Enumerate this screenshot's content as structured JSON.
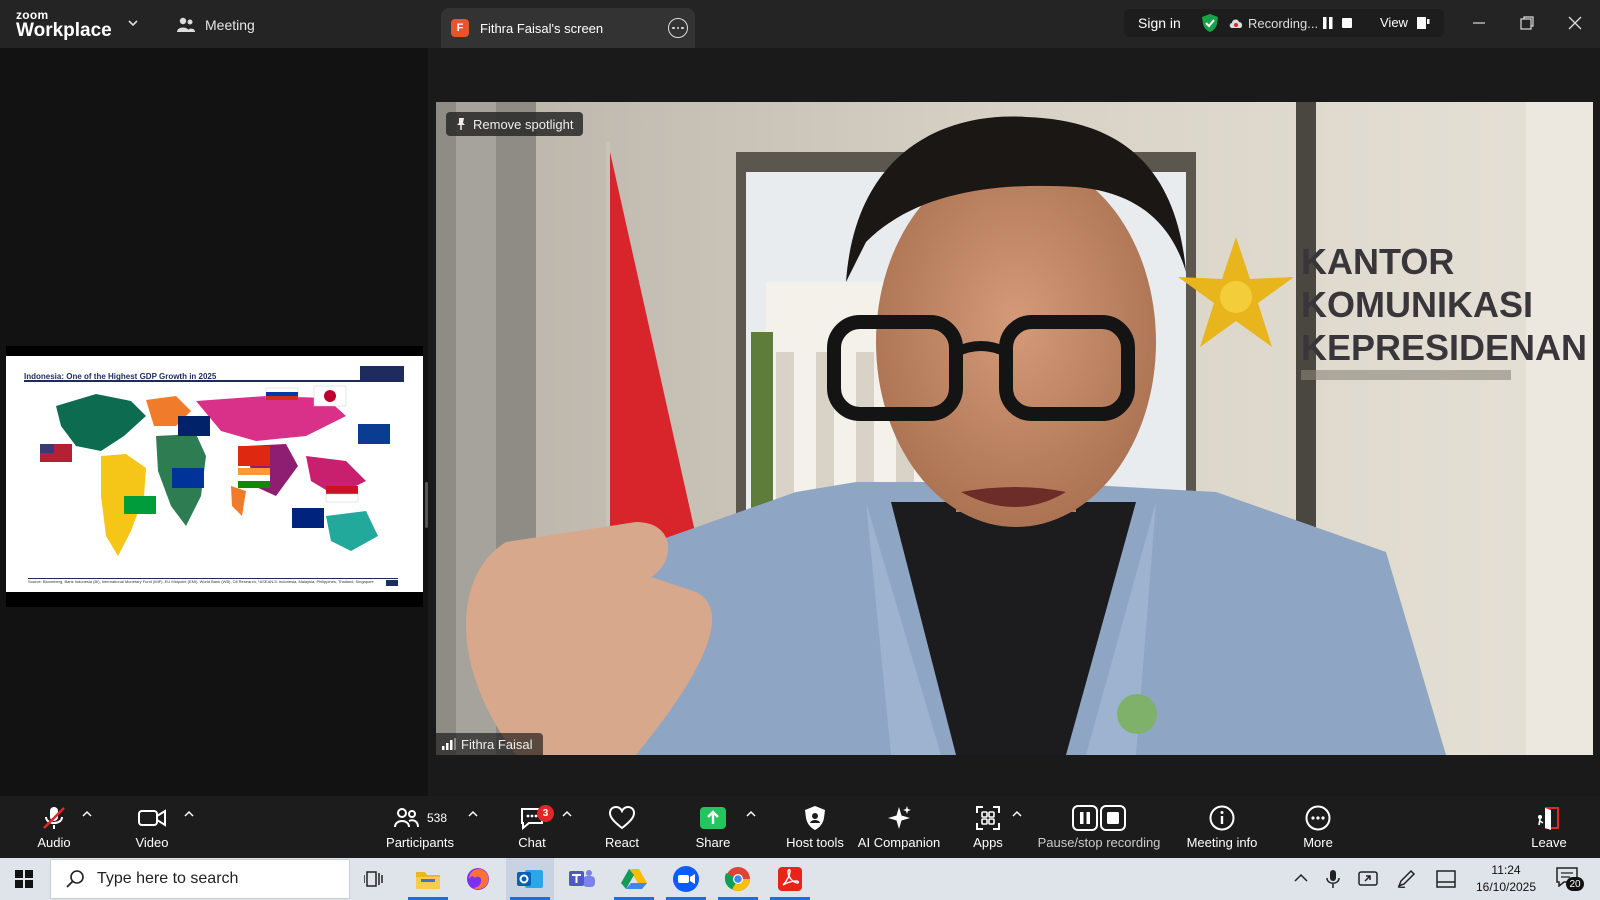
{
  "app": {
    "logo_top": "zoom",
    "logo_bottom": "Workplace",
    "meeting_tab": "Meeting",
    "screen_tab_badge": "F",
    "screen_tab_label": "Fithra Faisal's screen"
  },
  "status": {
    "sign_in": "Sign in",
    "recording": "Recording...",
    "view": "View"
  },
  "colors": {
    "accent_green": "#16a34a",
    "share_green": "#22c55e",
    "badge_red": "#e02828",
    "zoom_blue": "#0b5cff"
  },
  "slide": {
    "title": "Indonesia: One of the Highest GDP Growth in 2025",
    "source": "Source: Bloomberg, Bank Indonesia (BI), International Monetary Fund (IMF), EU Midpoint (EMI), World Bank (WB), Oil Research, *ASEAN-5: Indonesia, Malaysia, Philippines, Thailand, Singapore",
    "labels": [
      "USA",
      "UK",
      "Russia",
      "Japan",
      "China",
      "Eurozone",
      "India",
      "Brazil",
      "Australia",
      "ASEAN-5",
      "Indonesia"
    ]
  },
  "video": {
    "spotlight_button": "Remove spotlight",
    "participant_name": "Fithra Faisal",
    "backdrop_lines": [
      "KANTOR",
      "KOMUNIKASI",
      "KEPRESIDENAN"
    ]
  },
  "toolbar": {
    "audio": "Audio",
    "video": "Video",
    "participants": "Participants",
    "participants_count": "538",
    "chat": "Chat",
    "chat_badge": "3",
    "react": "React",
    "share": "Share",
    "host_tools": "Host tools",
    "ai_companion": "AI Companion",
    "apps": "Apps",
    "pause_stop": "Pause/stop recording",
    "meeting_info": "Meeting info",
    "more": "More",
    "leave": "Leave"
  },
  "taskbar": {
    "search_placeholder": "Type here to search",
    "time": "11:24",
    "date": "16/10/2025",
    "notifications": "20"
  }
}
